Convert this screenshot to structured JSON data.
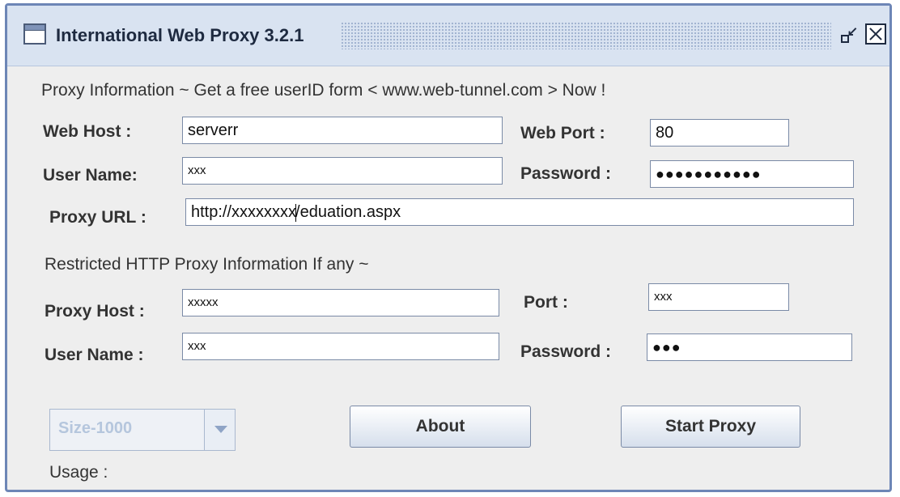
{
  "window": {
    "title": "International Web Proxy 3.2.1"
  },
  "proxy_info": {
    "header": "Proxy  Information ~ Get a free userID form < www.web-tunnel.com > Now !",
    "web_host_label": "Web Host :",
    "web_host_value": "serverr",
    "web_port_label": "Web Port :",
    "web_port_value": "80",
    "user_name_label": "User Name:",
    "user_name_value": "xxx",
    "password_label": "Password :",
    "password_value": "●●●●●●●●●●●",
    "proxy_url_label": "Proxy URL :",
    "proxy_url_before_caret": "http://xxxxxxxx",
    "proxy_url_after_caret": "/eduation.aspx"
  },
  "restricted_info": {
    "header": "Restricted HTTP Proxy Information If any ~",
    "proxy_host_label": "Proxy Host :",
    "proxy_host_value": "xxxxx",
    "port_label": "Port :",
    "port_value": "xxx",
    "user_name_label": "User Name :",
    "user_name_value": "xxx",
    "password_label": "Password :",
    "password_value": "●●●"
  },
  "controls": {
    "size_select_value": "Size-1000",
    "about_label": "About",
    "start_label": "Start Proxy",
    "usage_label": "Usage :"
  }
}
